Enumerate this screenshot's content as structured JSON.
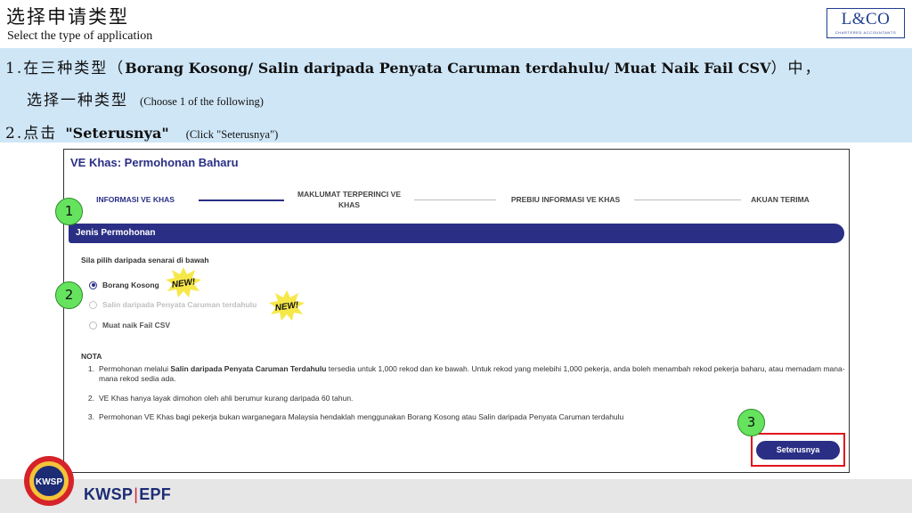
{
  "slide": {
    "title_cn": "选择申请类型",
    "title_en": "Select the type of application",
    "logo": {
      "main": "L&CO",
      "sub": "CHARTERED ACCOUNTANTS"
    }
  },
  "instructions": {
    "step1_prefix": "1.在三种类型（",
    "step1_types": "Borang Kosong/ Salin daripada Penyata Caruman terdahulu/ Muat Naik Fail CSV",
    "step1_suffix": "）中，",
    "step1_line2_cn": "选择一种类型",
    "step1_line2_en": "(Choose 1 of the following)",
    "step2_cn": "2.点击",
    "step2_button": "\"Seterusnya\"",
    "step2_en": "(Click \"Seterusnya\")"
  },
  "app": {
    "title": "VE Khas: Permohonan Baharu",
    "steps": [
      {
        "label": "INFORMASI VE KHAS"
      },
      {
        "label": "MAKLUMAT TERPERINCI VE KHAS"
      },
      {
        "label": "PREBIU INFORMASI VE KHAS"
      },
      {
        "label": "AKUAN TERIMA"
      }
    ],
    "section_title": "Jenis Permohonan",
    "select_prompt": "Sila pilih daripada senarai di bawah",
    "options": [
      {
        "label": "Borang Kosong",
        "selected": true,
        "disabled": false
      },
      {
        "label": "Salin daripada Penyata Caruman terdahulu",
        "selected": false,
        "disabled": true
      },
      {
        "label": "Muat naik Fail CSV",
        "selected": false,
        "disabled": false
      }
    ],
    "new_badge": "NEW!",
    "nota_title": "NOTA",
    "nota": [
      {
        "num": "1.",
        "pre": "Permohonan melalui ",
        "bold": "Salin daripada Penyata Caruman Terdahulu",
        "post": " tersedia untuk 1,000 rekod dan ke bawah. Untuk rekod yang melebihi 1,000 pekerja, anda boleh menambah rekod pekerja baharu, atau memadam mana-mana rekod sedia ada."
      },
      {
        "num": "2.",
        "text": "VE Khas hanya layak dimohon oleh ahli berumur kurang daripada 60 tahun."
      },
      {
        "num": "3.",
        "text": "Permohonan VE Khas bagi pekerja bukan warganegara Malaysia hendaklah menggunakan Borang Kosong atau Salin daripada Penyata Caruman terdahulu"
      }
    ],
    "next_button": "Seterusnya"
  },
  "markers": [
    "1",
    "2",
    "3"
  ],
  "footer": {
    "brand_left": "KWSP",
    "separator": "|",
    "brand_right": "EPF",
    "emblem_text": "KWSP"
  },
  "colors": {
    "navy": "#2a2f85",
    "band": "#cfe6f7",
    "marker_green": "#66e35e",
    "highlight_red": "#e0161b",
    "badge_yellow": "#f7e84a"
  }
}
